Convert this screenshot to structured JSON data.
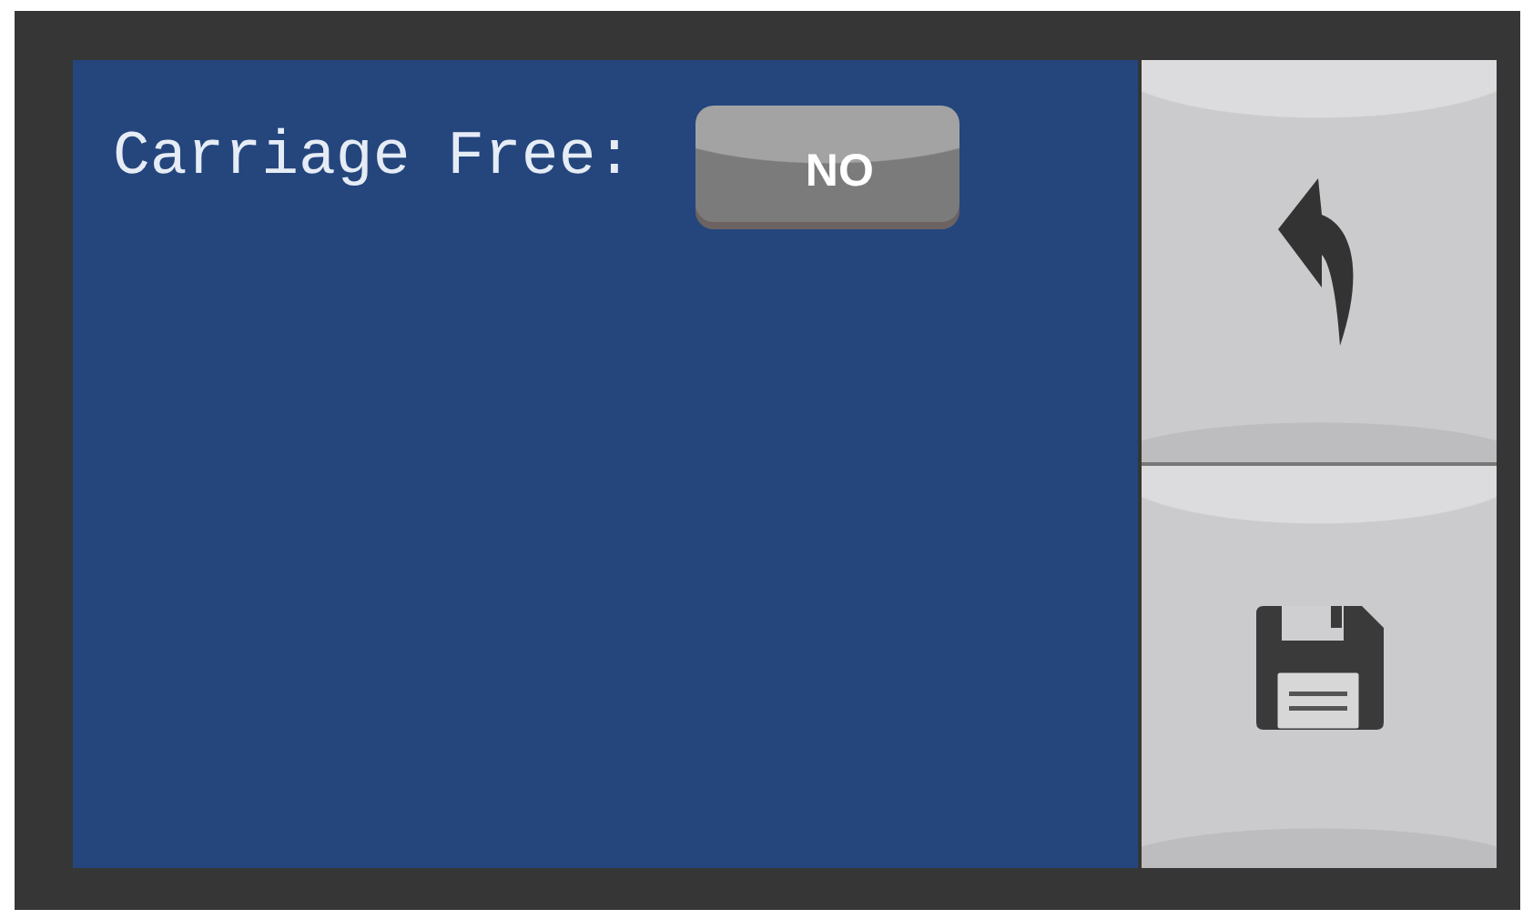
{
  "setting": {
    "label": "Carriage Free:",
    "value": "NO"
  },
  "buttons": [
    {
      "kind": "back"
    },
    {
      "kind": "save"
    }
  ]
}
